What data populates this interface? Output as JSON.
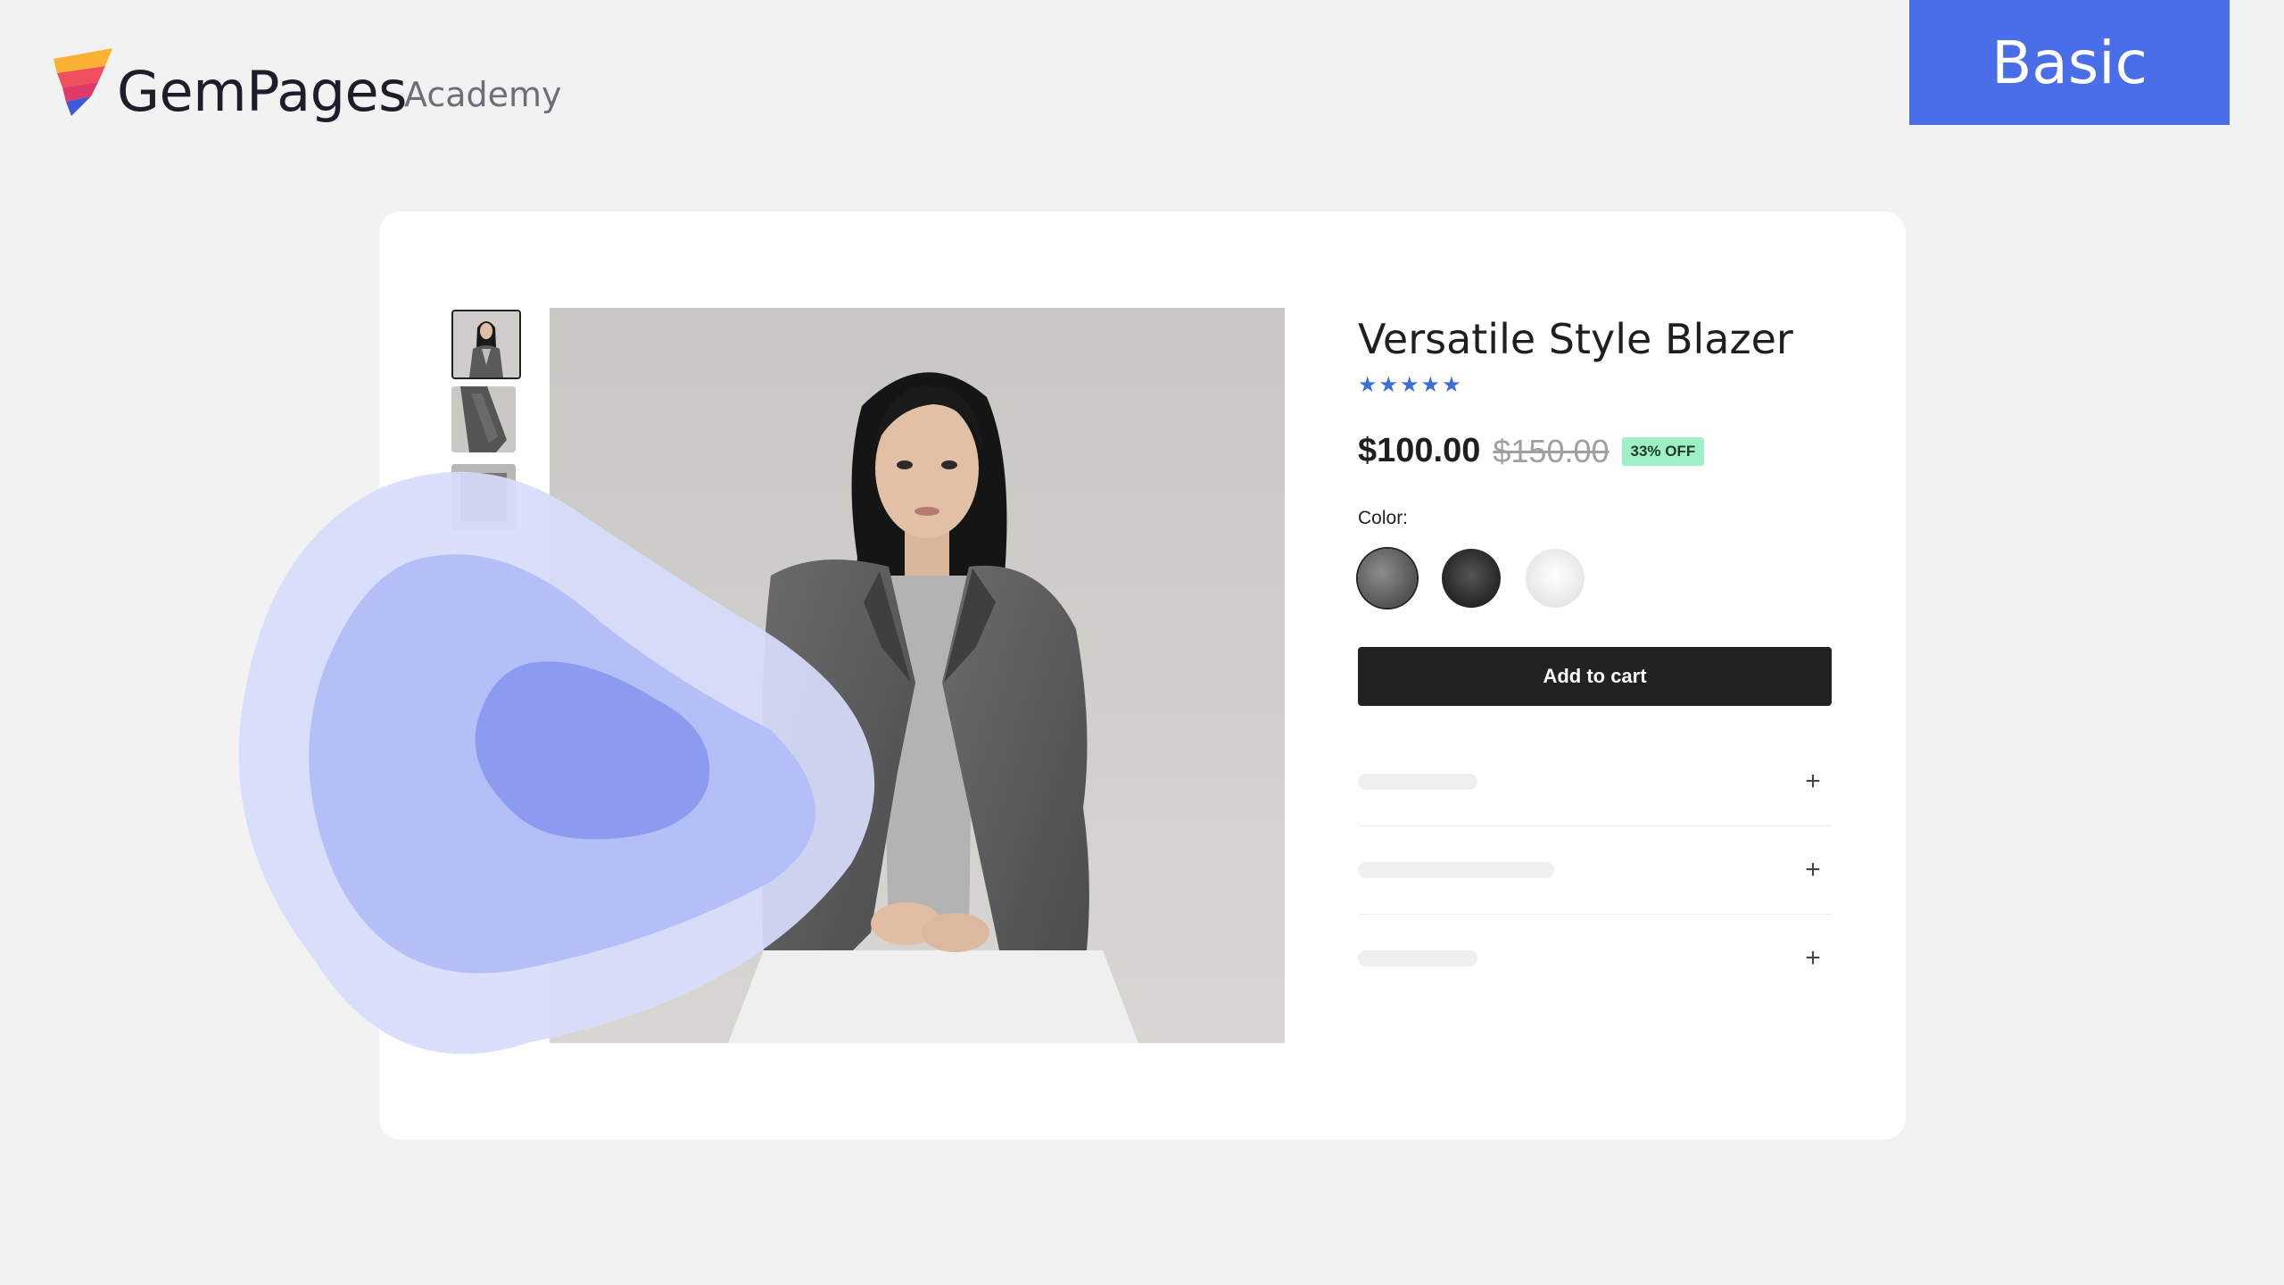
{
  "brand": {
    "name": "GemPages",
    "sub": "Academy"
  },
  "level_tab": {
    "label": "Basic"
  },
  "product": {
    "title": "Versatile Style Blazer",
    "rating_stars": "★★★★★",
    "price": "$100.00",
    "compare_price": "$150.00",
    "discount_badge": "33% OFF",
    "color_label": "Color:",
    "add_to_cart": "Add to cart",
    "accordion_toggle": "+"
  },
  "colors": {
    "accent": "#4a6ee8",
    "star": "#3c6fd6",
    "badge_bg": "#9ef0c4",
    "button": "#222222"
  }
}
